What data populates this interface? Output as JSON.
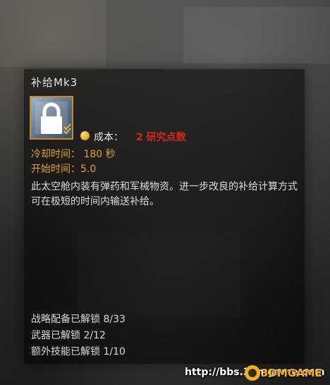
{
  "item": {
    "title": "补给Mk3",
    "icon": "lock-icon",
    "cost_label": "成本：",
    "cost_value": "2 研究点数",
    "cooldown": "冷却时间： 180 秒",
    "start_time": "开始时间：5.0",
    "description": "此太空舱内装有弹药和军械物资。进一步改良的补给计算方式可在极短的时间内输送补给。"
  },
  "unlocks": {
    "stratagems": "战略配备已解锁 8/33",
    "weapons": "武器已解锁 2/12",
    "perks": "额外技能已解锁 1/10"
  },
  "watermark": {
    "url": "http://bbs.3dmgame.com",
    "brand": "3DMGAME"
  },
  "colors": {
    "accent_orange": "#e0a030",
    "cost_red": "#d2281c",
    "icon_border": "#c9862a"
  }
}
